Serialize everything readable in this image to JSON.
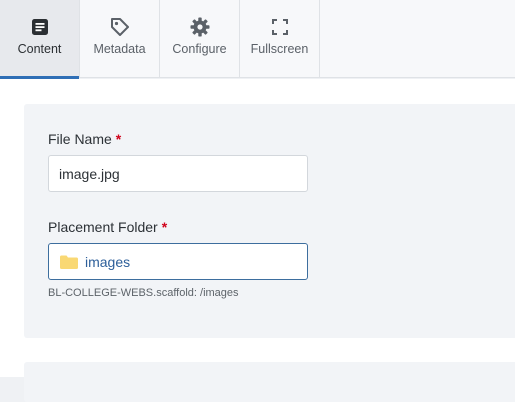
{
  "tabs": [
    {
      "label": "Content",
      "icon": "content-icon",
      "active": true
    },
    {
      "label": "Metadata",
      "icon": "tag-icon",
      "active": false
    },
    {
      "label": "Configure",
      "icon": "gear-icon",
      "active": false
    },
    {
      "label": "Fullscreen",
      "icon": "fullscreen-icon",
      "active": false
    }
  ],
  "form": {
    "file_name": {
      "label": "File Name",
      "required_mark": "*",
      "value": "image.jpg"
    },
    "placement_folder": {
      "label": "Placement Folder",
      "required_mark": "*",
      "value": "images",
      "icon": "folder-icon",
      "hint": "BL-COLLEGE-WEBS.scaffold: /images"
    }
  },
  "colors": {
    "accent": "#2f6fb6",
    "required": "#d0021b",
    "folder_text": "#2d5f9a",
    "folder_icon": "#f9d874"
  }
}
